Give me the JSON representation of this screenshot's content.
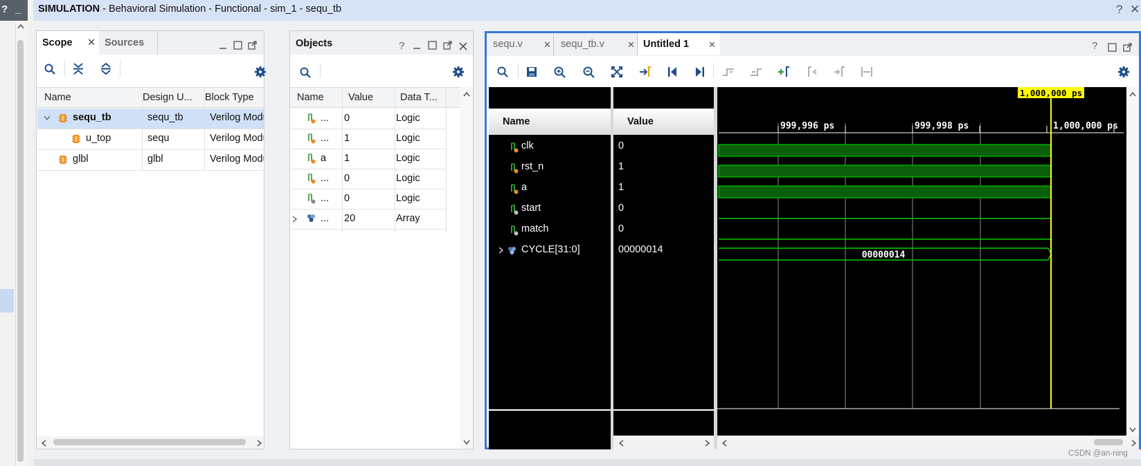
{
  "window": {
    "mode": "SIMULATION",
    "title_rest": " - Behavioral Simulation - Functional - sim_1 - sequ_tb",
    "help_glyph": "?",
    "close_glyph": "✕",
    "minimize_glyph": "_"
  },
  "scope_panel": {
    "tabs": [
      {
        "label": "Scope"
      },
      {
        "label": "Sources"
      }
    ],
    "columns": [
      "Name",
      "Design U...",
      "Block Type"
    ],
    "rows": [
      {
        "name": "sequ_tb",
        "design_unit": "sequ_tb",
        "block_type": "Verilog Module"
      },
      {
        "name": "u_top",
        "design_unit": "sequ",
        "block_type": "Verilog Module"
      },
      {
        "name": "glbl",
        "design_unit": "glbl",
        "block_type": "Verilog Module"
      }
    ]
  },
  "objects_panel": {
    "title": "Objects",
    "columns": [
      "Name",
      "Value",
      "Data T..."
    ],
    "rows": [
      {
        "name": "...",
        "value": "0",
        "type": "Logic",
        "icon": "input-signal-icon"
      },
      {
        "name": "...",
        "value": "1",
        "type": "Logic",
        "icon": "input-signal-icon"
      },
      {
        "name": "a",
        "value": "1",
        "type": "Logic",
        "icon": "input-signal-icon"
      },
      {
        "name": "...",
        "value": "0",
        "type": "Logic",
        "icon": "input-signal-icon"
      },
      {
        "name": "...",
        "value": "0",
        "type": "Logic",
        "icon": "output-signal-icon"
      },
      {
        "name": "...",
        "value": "20",
        "type": "Array",
        "icon": "array-icon"
      }
    ]
  },
  "waveform": {
    "tabs": [
      {
        "label": "sequ.v",
        "active": false
      },
      {
        "label": "sequ_tb.v",
        "active": false
      },
      {
        "label": "Untitled 1",
        "active": true
      }
    ],
    "name_header": "Name",
    "value_header": "Value",
    "cursor_label": "1,000,000 ps",
    "time_ticks": [
      "999,996 ps",
      "999,998 ps",
      "1,000,000 ps"
    ],
    "signals": [
      {
        "name": "clk",
        "value": "0"
      },
      {
        "name": "rst_n",
        "value": "1"
      },
      {
        "name": "a",
        "value": "1"
      },
      {
        "name": "start",
        "value": "0"
      },
      {
        "name": "match",
        "value": "0"
      },
      {
        "name": "CYCLE[31:0]",
        "value": "00000014"
      }
    ],
    "bus_value": "00000014",
    "colors": {
      "signal": "#00cc00",
      "high_fill": "#0b5f0b",
      "cursor": "#ffff00",
      "background": "#000000"
    }
  },
  "watermark": "CSDN @an-ning"
}
